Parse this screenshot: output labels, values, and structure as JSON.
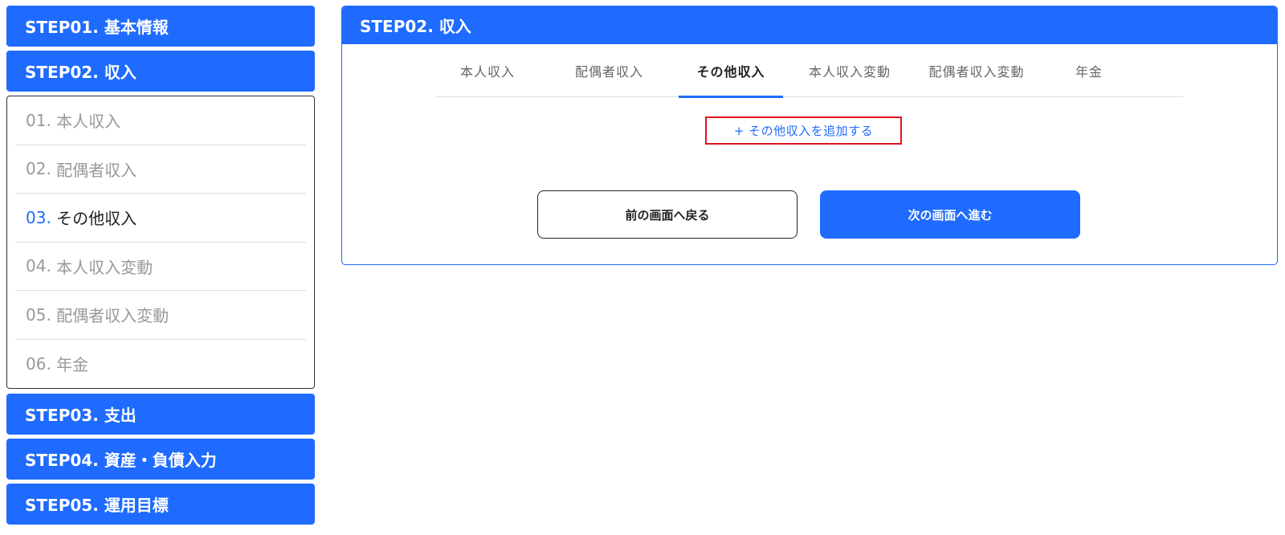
{
  "sidebar": {
    "steps_top": [
      {
        "label": "STEP01. 基本情報"
      },
      {
        "label": "STEP02. 収入"
      }
    ],
    "sub_items": [
      {
        "num": "01.",
        "label": "本人収入"
      },
      {
        "num": "02.",
        "label": "配偶者収入"
      },
      {
        "num": "03.",
        "label": "その他収入"
      },
      {
        "num": "04.",
        "label": "本人収入変動"
      },
      {
        "num": "05.",
        "label": "配偶者収入変動"
      },
      {
        "num": "06.",
        "label": "年金"
      }
    ],
    "active_sub": 2,
    "steps_bottom": [
      {
        "label": "STEP03. 支出"
      },
      {
        "label": "STEP04. 資産・負債入力"
      },
      {
        "label": "STEP05. 運用目標"
      }
    ]
  },
  "panel": {
    "title": "STEP02. 収入",
    "tabs": [
      {
        "label": "本人収入"
      },
      {
        "label": "配偶者収入"
      },
      {
        "label": "その他収入"
      },
      {
        "label": "本人収入変動"
      },
      {
        "label": "配偶者収入変動"
      },
      {
        "label": "年金"
      }
    ],
    "active_tab": 2,
    "add_link": "+ その他収入を追加する",
    "back_button": "前の画面へ戻る",
    "next_button": "次の画面へ進む"
  },
  "colors": {
    "accent": "#1f6bff",
    "highlight_border": "#e0141e"
  }
}
